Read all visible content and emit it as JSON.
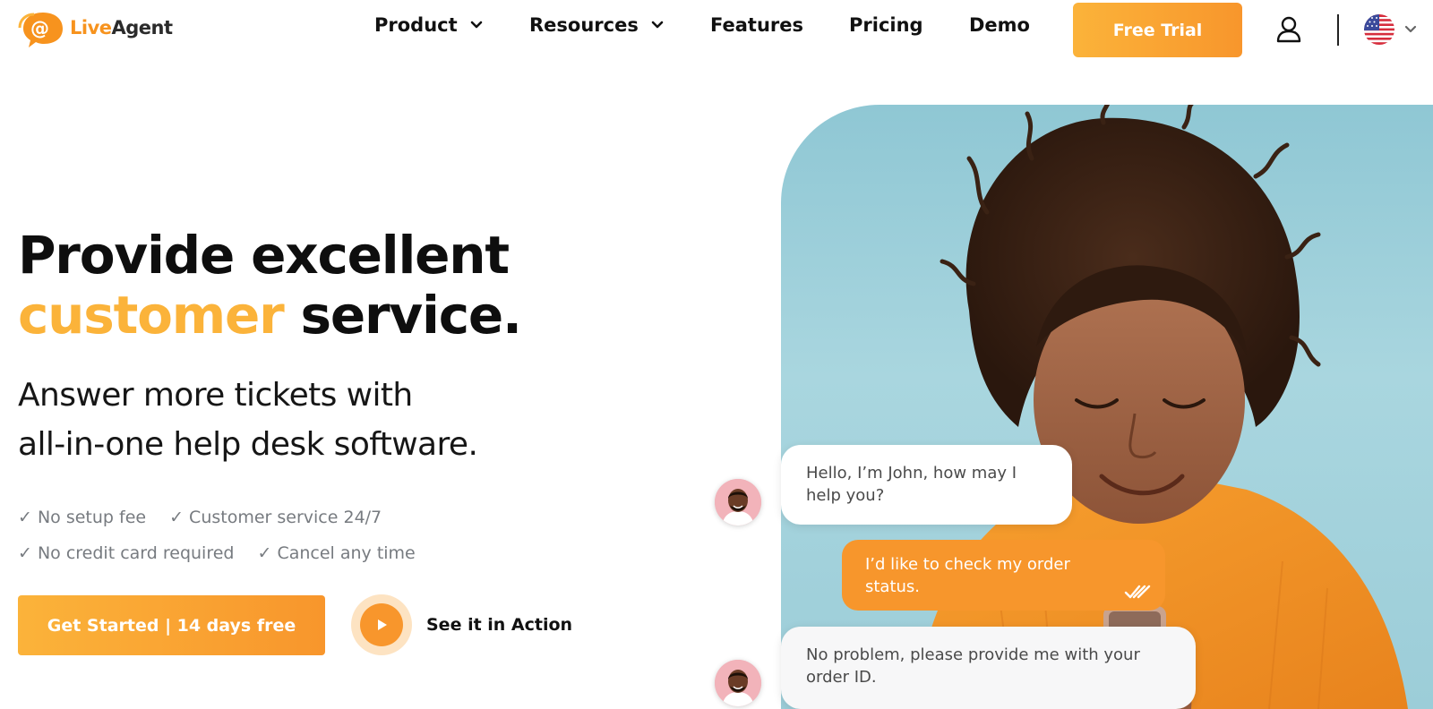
{
  "brand": {
    "live": "Live",
    "agent": "Agent",
    "accent_color": "#f7931e"
  },
  "nav": {
    "items": [
      {
        "label": "Product",
        "has_dropdown": true
      },
      {
        "label": "Resources",
        "has_dropdown": true
      },
      {
        "label": "Features",
        "has_dropdown": false
      },
      {
        "label": "Pricing",
        "has_dropdown": false
      },
      {
        "label": "Demo",
        "has_dropdown": false
      }
    ],
    "cta_label": "Free Trial",
    "account_icon": "user-icon",
    "language_icon": "us-flag-icon"
  },
  "hero": {
    "title_line1": "Provide excellent",
    "title_accent": "customer",
    "title_rest": " service.",
    "subtitle_line1": "Answer more tickets with",
    "subtitle_line2": "all-in-one help desk software.",
    "bullets": [
      "✓ No setup fee",
      "✓ Customer service 24/7",
      "✓ No credit card required",
      "✓ Cancel any time"
    ],
    "primary_cta": "Get Started | 14 days free",
    "secondary_cta": "See it in Action",
    "accent_color": "#fbb33a",
    "cta_color": "#f8962c"
  },
  "chat": {
    "messages": [
      {
        "from": "agent",
        "line1": "Hello, I’m John, how may I",
        "line2": "help you?"
      },
      {
        "from": "customer",
        "line1": "I’d like to check my order",
        "line2": "status."
      },
      {
        "from": "agent",
        "line1": "No problem, please provide me with your",
        "line2": "order ID."
      }
    ]
  }
}
